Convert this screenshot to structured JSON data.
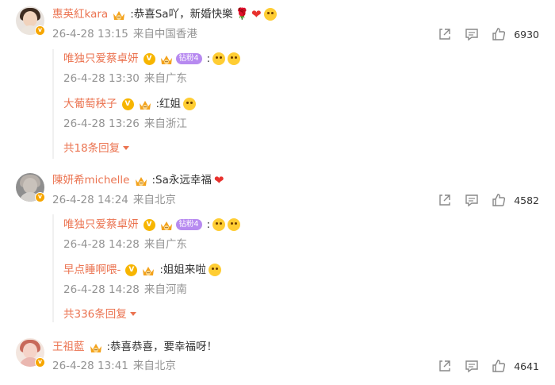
{
  "comments": [
    {
      "name": "惠英紅kara",
      "text": ":恭喜Sa吖，新婚快樂",
      "date": "26-4-28 13:15",
      "location": "来自中国香港",
      "likes": "6930",
      "replies": [
        {
          "name": "唯独只爱蔡卓妍",
          "level": "钻粉4",
          "text": ":",
          "date": "26-4-28 13:30",
          "location": "来自广东"
        },
        {
          "name": "大葡萄秧子",
          "text": ":红姐",
          "date": "26-4-28 13:26",
          "location": "来自浙江"
        }
      ],
      "more": "共18条回复"
    },
    {
      "name": "陳妍希michelle",
      "text": ":Sa永远幸福",
      "date": "26-4-28 14:24",
      "location": "来自北京",
      "likes": "4582",
      "replies": [
        {
          "name": "唯独只爱蔡卓妍",
          "level": "钻粉4",
          "text": ":",
          "date": "26-4-28 14:28",
          "location": "来自广东"
        },
        {
          "name": "早点睡啊喂-",
          "text": ":姐姐来啦",
          "date": "26-4-28 14:28",
          "location": "来自河南"
        }
      ],
      "more": "共336条回复"
    },
    {
      "name": "王祖藍",
      "text": ":恭喜恭喜，要幸福呀！",
      "date": "26-4-28 13:41",
      "location": "来自北京",
      "likes": "4641"
    }
  ],
  "icons": {
    "share": "share-icon",
    "comment": "comment-icon",
    "like": "like-icon",
    "verified": "verified-v-icon",
    "fan_crown": "fan-crown-icon"
  },
  "colors": {
    "name": "#eb7350",
    "meta": "#939393",
    "verified": "#f7a600",
    "level": "#b78af0"
  }
}
